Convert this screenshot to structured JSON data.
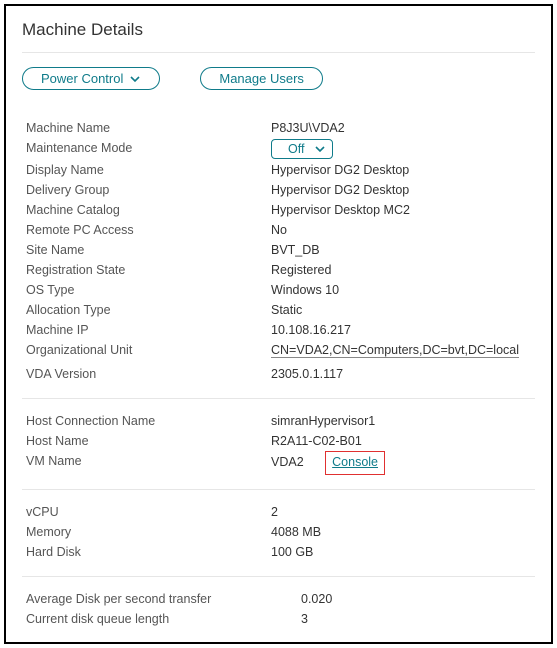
{
  "title": "Machine Details",
  "toolbar": {
    "power_control_label": "Power Control",
    "manage_users_label": "Manage Users"
  },
  "labels": {
    "machine_name": "Machine Name",
    "maintenance_mode": "Maintenance Mode",
    "display_name": "Display Name",
    "delivery_group": "Delivery Group",
    "machine_catalog": "Machine Catalog",
    "remote_pc_access": "Remote PC Access",
    "site_name": "Site Name",
    "registration_state": "Registration State",
    "os_type": "OS Type",
    "allocation_type": "Allocation Type",
    "machine_ip": "Machine IP",
    "organizational_unit": "Organizational Unit",
    "vda_version": "VDA Version",
    "host_connection_name": "Host Connection Name",
    "host_name": "Host Name",
    "vm_name": "VM Name",
    "vcpu": "vCPU",
    "memory": "Memory",
    "hard_disk": "Hard Disk",
    "avg_disk_transfer": "Average Disk per second transfer",
    "current_disk_queue": "Current disk queue length"
  },
  "values": {
    "machine_name": "P8J3U\\VDA2",
    "maintenance_mode_selected": "Off",
    "display_name": "Hypervisor DG2 Desktop",
    "delivery_group": "Hypervisor DG2 Desktop",
    "machine_catalog": "Hypervisor Desktop MC2",
    "remote_pc_access": "No",
    "site_name": "BVT_DB",
    "registration_state": "Registered",
    "os_type": "Windows 10",
    "allocation_type": "Static",
    "machine_ip": "10.108.16.217",
    "organizational_unit": "CN=VDA2,CN=Computers,DC=bvt,DC=local",
    "vda_version": "2305.0.1.117",
    "host_connection_name": "simranHypervisor1",
    "host_name": "R2A11-C02-B01",
    "vm_name": "VDA2",
    "console_link": "Console",
    "vcpu": "2",
    "memory": "4088 MB",
    "hard_disk": "100 GB",
    "avg_disk_transfer": "0.020",
    "current_disk_queue": "3"
  }
}
